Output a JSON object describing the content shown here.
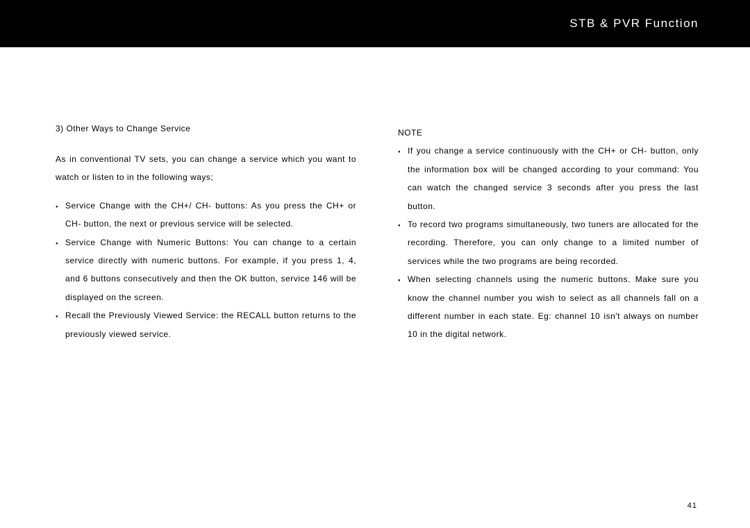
{
  "header": {
    "title": "STB & PVR Function"
  },
  "left": {
    "section_title": "3) Other Ways to Change Service",
    "intro": "As in conventional TV sets, you can change a service which you want to watch or listen to in the following ways;",
    "bullets": [
      "Service Change with the CH+/ CH- buttons: As you press the CH+ or CH- button, the next or previous service will be selected.",
      "Service Change with Numeric Buttons: You can change to a certain service directly with numeric buttons. For example, if you press 1, 4, and 6 buttons consecutively and then the OK button, service 146 will be displayed on the screen.",
      "Recall the Previously Viewed Service: the RECALL button returns to the previously viewed service."
    ]
  },
  "right": {
    "note_label": "NOTE",
    "bullets": [
      "If you change a service continuously with the CH+ or CH- button, only the information box will be changed according to your command: You can watch the changed service 3 seconds after you press the last button.",
      "To record two programs simultaneously, two tuners are allocated for the recording. Therefore, you can only change to a limited number of services while the two programs are being recorded.",
      "When selecting channels using the numeric buttons. Make sure you know the channel number you wish to select as all channels fall on a different number in each state. Eg: channel 10 isn't always on number 10 in the digital network."
    ]
  },
  "page_number": "41"
}
